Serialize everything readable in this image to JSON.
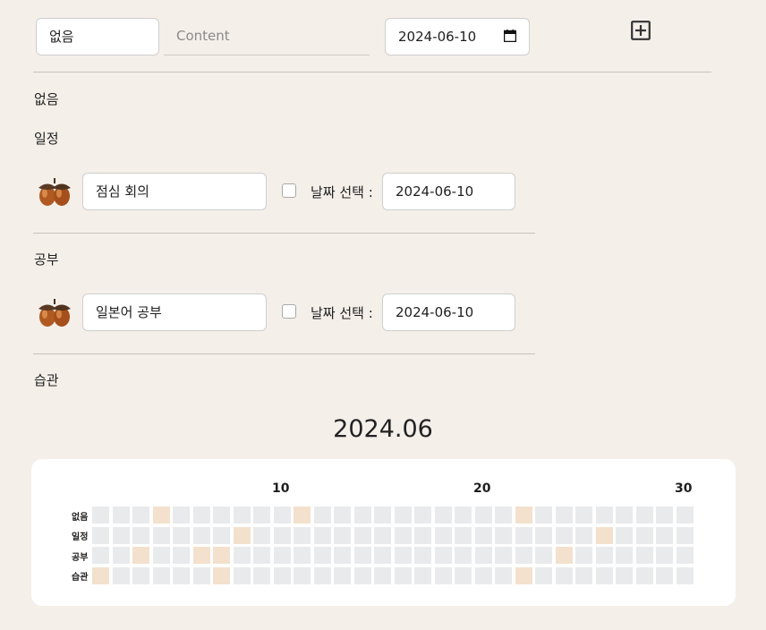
{
  "form": {
    "category_value": "없음",
    "content_placeholder": "Content",
    "date_value": "2024-06-10"
  },
  "sections": [
    {
      "label": "없음",
      "items": []
    },
    {
      "label": "일정",
      "items": [
        {
          "text": "점심 회의",
          "checkbox_label": "날짜 선택 :",
          "date": "2024-06-10",
          "checked": false
        }
      ]
    },
    {
      "label": "공부",
      "items": [
        {
          "text": "일본어 공부",
          "checkbox_label": "날짜 선택 :",
          "date": "2024-06-10",
          "checked": false
        }
      ]
    },
    {
      "label": "습관",
      "items": []
    }
  ],
  "heatmap": {
    "month_title": "2024.06",
    "day_ticks": [
      "10",
      "20",
      "30"
    ],
    "rows": [
      {
        "label": "없음",
        "active_days": [
          4,
          11,
          22
        ]
      },
      {
        "label": "일정",
        "active_days": [
          8,
          26
        ]
      },
      {
        "label": "공부",
        "active_days": [
          3,
          6,
          7,
          24
        ]
      },
      {
        "label": "습관",
        "active_days": [
          1,
          7,
          22
        ]
      }
    ],
    "days": 30,
    "colors": {
      "empty": "#e9eaec",
      "active": "#f3e1cd"
    }
  }
}
